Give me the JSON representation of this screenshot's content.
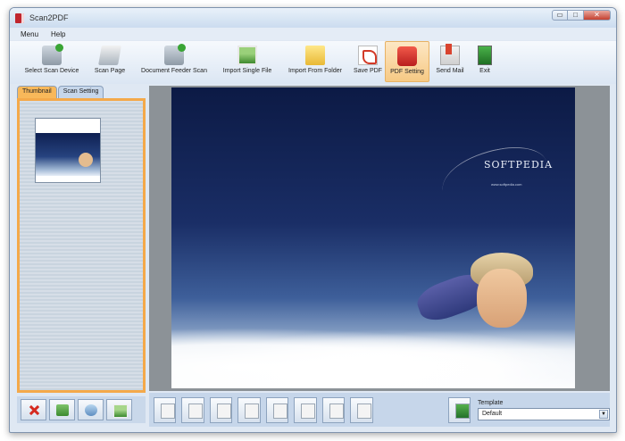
{
  "window": {
    "title": "Scan2PDF",
    "controls": {
      "minimize": "▭",
      "maximize": "□",
      "close": "✕"
    }
  },
  "menu": {
    "items": [
      {
        "id": "menu-menu",
        "label": "Menu"
      },
      {
        "id": "menu-help",
        "label": "Help"
      }
    ]
  },
  "toolbar": {
    "buttons": [
      {
        "label": "Select Scan Device",
        "icon": "scanner-device-icon"
      },
      {
        "label": "Scan Page",
        "icon": "scan-page-icon"
      },
      {
        "label": "Document Feeder Scan",
        "icon": "document-feeder-icon"
      },
      {
        "label": "Import Single File",
        "icon": "import-image-icon"
      },
      {
        "label": "Import From Folder",
        "icon": "folder-icon"
      },
      {
        "label": "Save PDF",
        "icon": "pdf-icon"
      },
      {
        "label": "PDF Setting",
        "icon": "pdf-setting-icon",
        "active": true
      },
      {
        "label": "Send Mail",
        "icon": "mail-icon"
      },
      {
        "label": "Exit",
        "icon": "exit-icon"
      }
    ]
  },
  "left_panel": {
    "tabs": [
      {
        "label": "Thumbnail",
        "active": true
      },
      {
        "label": "Scan Setting",
        "active": false
      }
    ],
    "bottom_buttons": [
      "delete-icon",
      "recycle-icon",
      "scan-icon",
      "image-icon"
    ]
  },
  "preview": {
    "watermark_logo": "SOFTPEDIA",
    "watermark_url": "www.softpedia.com"
  },
  "bottom_bar": {
    "buttons": [
      "rotate-icon",
      "page-icon",
      "blank-page-icon",
      "move-icon",
      "save-icon",
      "image-icon",
      "refresh-icon",
      "save-check-icon"
    ],
    "flag_icon": "flag-icon",
    "template_label": "Template",
    "template_value": "Default"
  },
  "colors": {
    "accent_orange": "#f4a94a",
    "panel_blue": "#c6d6ea",
    "viewer_gray": "#8c9297"
  }
}
